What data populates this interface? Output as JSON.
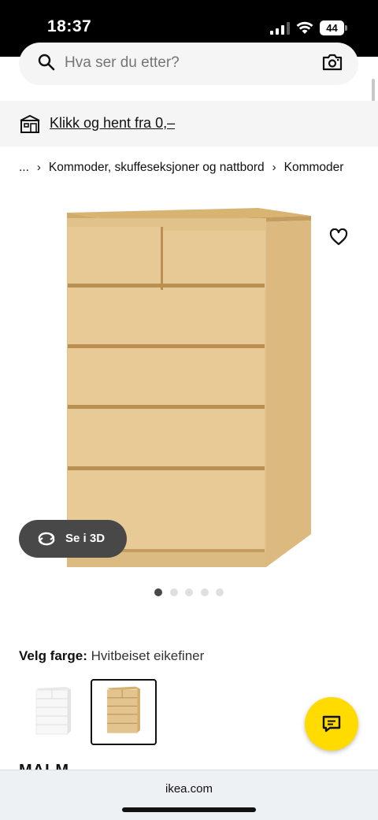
{
  "status_bar": {
    "time": "18:37",
    "battery": "44"
  },
  "search": {
    "placeholder": "Hva ser du etter?"
  },
  "pickup": {
    "link_text": "Klikk og hent fra 0,–"
  },
  "breadcrumb": {
    "items": [
      "...",
      "Kommoder, skuffeseksjoner og nattbord",
      "Kommoder"
    ]
  },
  "viewer": {
    "button_3d": "Se i 3D",
    "image_count": 5,
    "active_index": 0
  },
  "color_select": {
    "label": "Velg farge:",
    "value": "Hvitbeiset eikefiner",
    "selected_index": 1
  },
  "product": {
    "name": "MALM"
  },
  "browser": {
    "url": "ikea.com"
  },
  "colors": {
    "accent_yellow": "#ffdb00",
    "dark_button": "#484848",
    "oak": "#e5c793",
    "oak_dark": "#c69d60"
  }
}
